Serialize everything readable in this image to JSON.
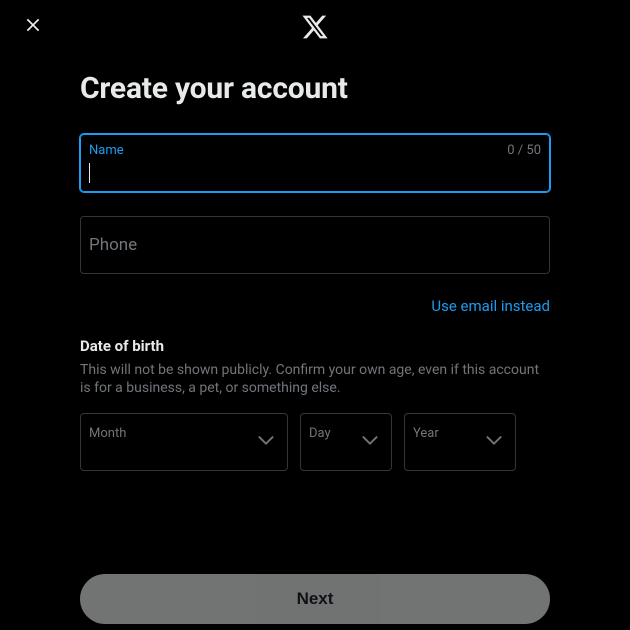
{
  "header": {
    "close_icon": "close",
    "logo": "x-logo"
  },
  "title": "Create your account",
  "fields": {
    "name": {
      "label": "Name",
      "value": "",
      "counter": "0 / 50"
    },
    "phone": {
      "label": "Phone",
      "value": ""
    }
  },
  "alt_link": "Use email instead",
  "dob": {
    "heading": "Date of birth",
    "description": "This will not be shown publicly. Confirm your own age, even if this account is for a business, a pet, or something else.",
    "month_label": "Month",
    "day_label": "Day",
    "year_label": "Year",
    "month_value": "",
    "day_value": "",
    "year_value": ""
  },
  "next_button": "Next",
  "colors": {
    "accent": "#1d9bf0",
    "background": "#000000",
    "text": "#e7e9ea",
    "muted": "#71767b",
    "border": "#333639",
    "disabled_button": "#787a7a"
  }
}
